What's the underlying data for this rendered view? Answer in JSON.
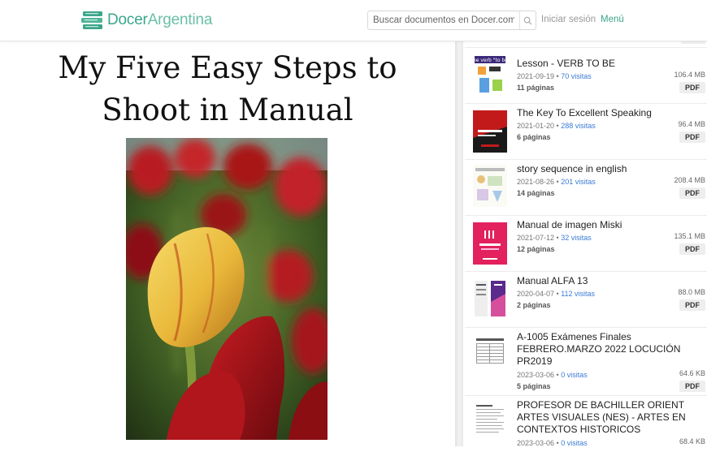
{
  "header": {
    "logo_bold": "Docer",
    "logo_light": "Argentina",
    "search_placeholder": "Buscar documentos en Docer.com.ar",
    "login": "Iniciar sesión",
    "menu": "Menú"
  },
  "document": {
    "title_line1": "My Five Easy Steps to",
    "title_line2": "Shoot in Manual"
  },
  "colors": {
    "brand": "#3aa68a",
    "link": "#3a7bd5"
  },
  "sidebar": {
    "items": [
      {
        "title": "Lesson - VERB TO BE",
        "date": "2021-09-19",
        "visits": "70 visitas",
        "pages": "11 páginas",
        "size": "106.4 MB",
        "format": "PDF"
      },
      {
        "title": "The Key To Excellent Speaking",
        "date": "2021-01-20",
        "visits": "288 visitas",
        "pages": "6 páginas",
        "size": "96.4 MB",
        "format": "PDF"
      },
      {
        "title": "story sequence in english",
        "date": "2021-08-26",
        "visits": "201 visitas",
        "pages": "14 páginas",
        "size": "208.4 MB",
        "format": "PDF"
      },
      {
        "title": "Manual de imagen Miski",
        "date": "2021-07-12",
        "visits": "32 visitas",
        "pages": "12 páginas",
        "size": "135.1 MB",
        "format": "PDF"
      },
      {
        "title": "Manual ALFA 13",
        "date": "2020-04-07",
        "visits": "112 visitas",
        "pages": "2 páginas",
        "size": "88.0 MB",
        "format": "PDF"
      },
      {
        "title": "A-1005 Exámenes Finales FEBRERO.MARZO 2022 LOCUCIÓN PR2019",
        "date": "2023-03-06",
        "visits": "0 visitas",
        "pages": "5 páginas",
        "size": "64.6 KB",
        "format": "PDF"
      },
      {
        "title": "PROFESOR DE BACHILLER ORIENT ARTES VISUALES (NES) - ARTES EN CONTEXTOS HISTORICOS",
        "date": "2023-03-06",
        "visits": "0 visitas",
        "size": "68.4 KB"
      }
    ]
  }
}
